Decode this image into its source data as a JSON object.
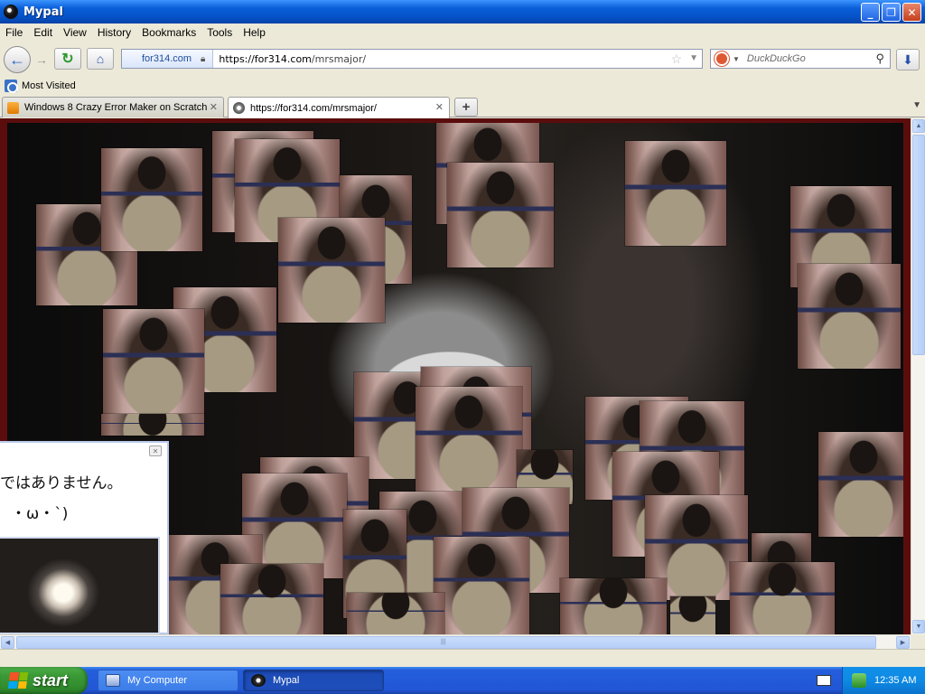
{
  "window": {
    "title": "Mypal",
    "buttons": [
      "_",
      "❐",
      "✕"
    ]
  },
  "menu": [
    "File",
    "Edit",
    "View",
    "History",
    "Bookmarks",
    "Tools",
    "Help"
  ],
  "navigation": {
    "identity": "for314.com",
    "url_host": "https://for314.com",
    "url_path": "/mrsmajor/",
    "search_engine": "DuckDuckGo"
  },
  "bookmarks": {
    "item": "Most Visited"
  },
  "tabs": [
    {
      "label": "Windows 8 Crazy Error Maker on Scratch",
      "active": false
    },
    {
      "label": "https://for314.com/mrsmajor/",
      "active": true
    }
  ],
  "popup": {
    "line1": "ではありません。",
    "line2": "・ω・`)"
  },
  "taskbar": {
    "start": "start",
    "items": [
      "My Computer",
      "Mypal"
    ],
    "clock": "12:35 AM"
  },
  "colors": {
    "titlebar": "#0653c9",
    "content_border": "#5b0d0d",
    "taskbar": "#2156d5",
    "start": "#3c9a37"
  }
}
